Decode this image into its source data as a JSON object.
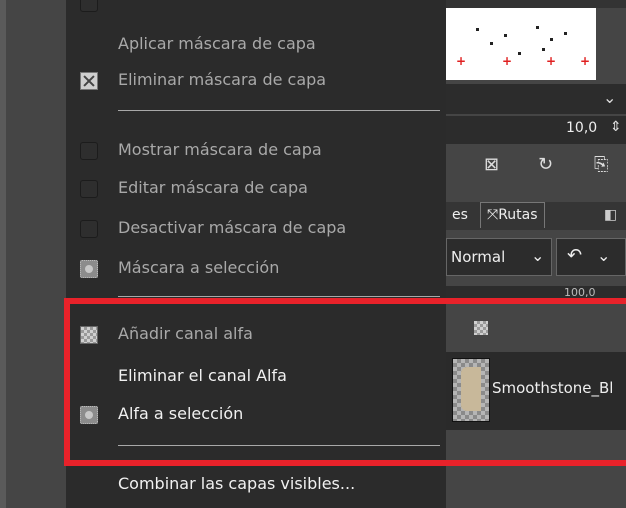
{
  "menu": {
    "items": [
      {
        "id": "apply-mask",
        "label": "Aplicar máscara de capa",
        "state": "disabled",
        "icon": ""
      },
      {
        "id": "delete-mask",
        "label": "Eliminar máscara de capa",
        "state": "disabled",
        "icon": "delete-mask-icon"
      },
      {
        "id": "show-mask",
        "label": "Mostrar máscara de capa",
        "state": "disabled",
        "icon": "toggle-icon"
      },
      {
        "id": "edit-mask",
        "label": "Editar máscara de capa",
        "state": "disabled",
        "icon": "toggle-icon"
      },
      {
        "id": "disable-mask",
        "label": "Desactivar máscara de capa",
        "state": "disabled",
        "icon": "toggle-icon"
      },
      {
        "id": "mask-to-selection",
        "label": "Máscara a selección",
        "state": "disabled",
        "icon": "selection-icon"
      },
      {
        "id": "add-alpha",
        "label": "Añadir canal alfa",
        "state": "disabled",
        "icon": "alpha-checker-icon"
      },
      {
        "id": "remove-alpha",
        "label": "Eliminar el canal Alfa",
        "state": "enabled",
        "icon": ""
      },
      {
        "id": "alpha-to-selection",
        "label": "Alfa a selección",
        "state": "enabled",
        "icon": "selection-icon"
      },
      {
        "id": "merge-visible",
        "label": "Combinar las capas visibles...",
        "state": "enabled",
        "icon": ""
      }
    ]
  },
  "dock": {
    "number_value": "10,0",
    "tabs": {
      "partial": "es",
      "paths": "Rutas"
    },
    "mode": "Normal",
    "opacity_value": "100,0",
    "layer_name": "Smoothstone_Bl"
  },
  "colors": {
    "menu_bg": "#2b2b2b",
    "panel_bg": "#454545",
    "highlight": "#e8222a"
  }
}
